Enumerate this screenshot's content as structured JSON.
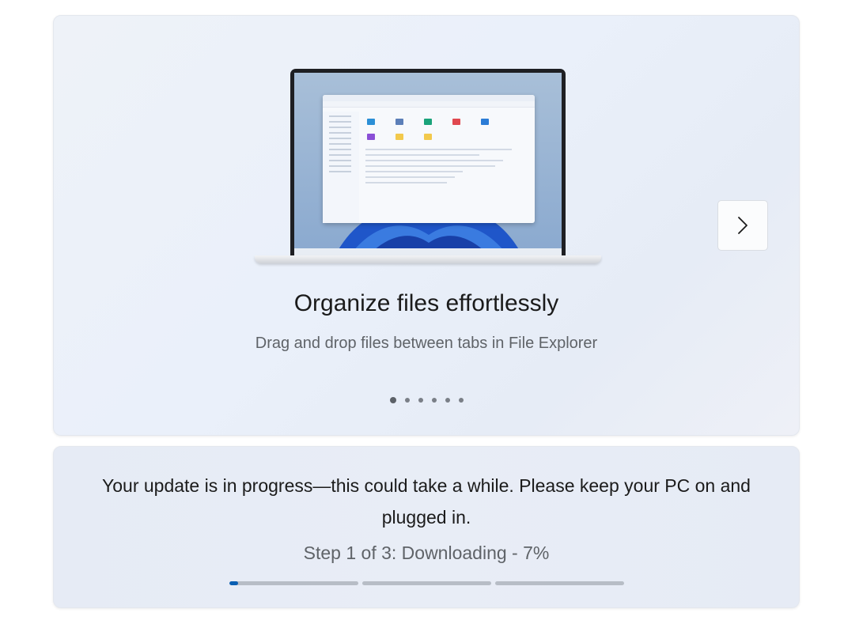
{
  "carousel": {
    "headline": "Organize files effortlessly",
    "description": "Drag and drop files between tabs in File Explorer",
    "next_icon": "chevron-right-icon",
    "slide_count": 6,
    "active_slide": 1
  },
  "update": {
    "message": "Your update is in progress—this could take a while. Please keep your PC on and plugged in.",
    "step_text": "Step 1 of 3: Downloading - 7%",
    "steps": [
      {
        "progress": 0.07
      },
      {
        "progress": 0
      },
      {
        "progress": 0
      }
    ]
  },
  "colors": {
    "accent": "#0a5fb3",
    "track": "#b7bdc6"
  }
}
